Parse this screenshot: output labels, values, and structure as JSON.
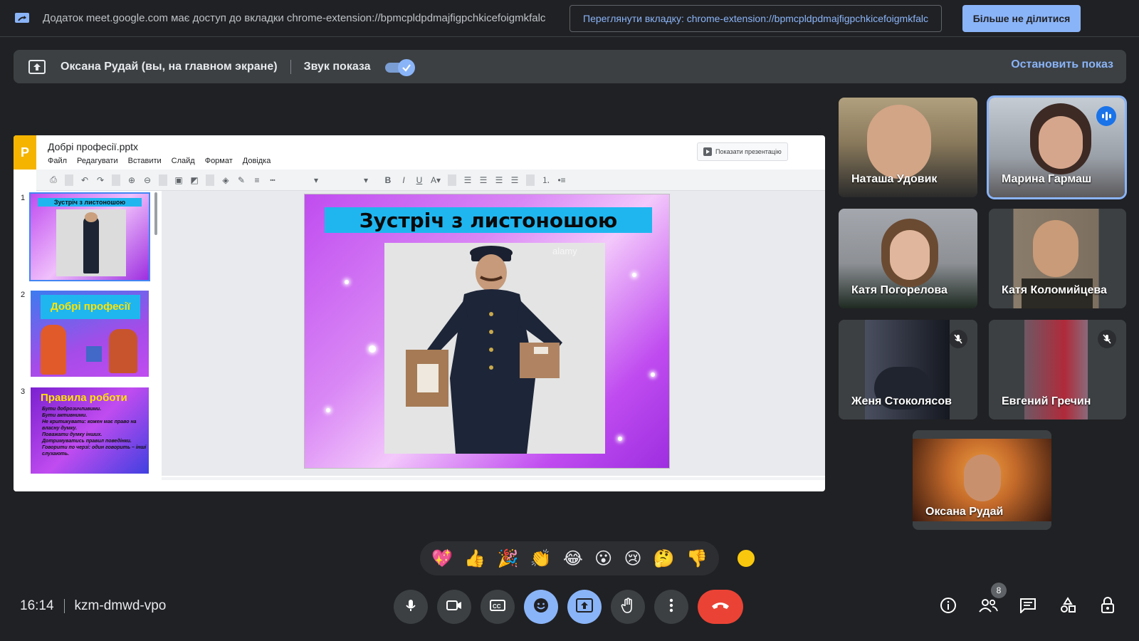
{
  "share_bar": {
    "message": "Додаток meet.google.com має доступ до вкладки chrome-extension://bpmcpldpdmajfigpchkicefoigmkfalc",
    "view_tab_label": "Переглянути вкладку: chrome-extension://bpmcpldpdmajfigpchkicefoigmkfalc",
    "stop_sharing_label": "Більше не ділитися"
  },
  "presenting_bar": {
    "presenter": "Оксана Рудай (вы, на главном экране)",
    "audio_label": "Звук показа",
    "audio_on": true,
    "stop_label": "Остановить показ"
  },
  "slides_app": {
    "doc_title": "Добрі професії.pptx",
    "logo_letter": "P",
    "menus": [
      "Файл",
      "Редагувати",
      "Вставити",
      "Слайд",
      "Формат",
      "Довідка"
    ],
    "present_label": "Показати презентацію",
    "thumbnails": [
      {
        "num": "1",
        "title": "Зустріч з листоношою"
      },
      {
        "num": "2",
        "title": "Добрі професії"
      },
      {
        "num": "3",
        "title": "Правила роботи",
        "lines": [
          "Бути доброзичливими.",
          "Бути активними.",
          "Не критикувати: кожен має право на власну думку.",
          "Поважати думку інших.",
          "Дотримуватись правил поведінки.",
          "Говорити по черзі: один говорить – інші слухають."
        ]
      }
    ],
    "current_slide_title": "Зустріч з листоношою",
    "watermark": "alamy"
  },
  "participants": [
    {
      "name": "Наташа Удовик",
      "muted": false,
      "speaking": false,
      "colors": [
        "#8a7a5c",
        "#2b2b2b"
      ]
    },
    {
      "name": "Марина Гармаш",
      "muted": false,
      "speaking": true,
      "colors": [
        "#b9bfc8",
        "#3d2a24"
      ]
    },
    {
      "name": "Катя Погорелова",
      "muted": false,
      "speaking": false,
      "colors": [
        "#9c9fa5",
        "#1e2a22"
      ]
    },
    {
      "name": "Катя Коломийцева",
      "muted": false,
      "speaking": false,
      "colors": [
        "#7d6f60",
        "#2c2a24"
      ]
    },
    {
      "name": "Женя Стоколясов",
      "muted": true,
      "speaking": false,
      "colors": [
        "#3a3f52",
        "#151820"
      ]
    },
    {
      "name": "Евгений Гречин",
      "muted": true,
      "speaking": false,
      "colors": [
        "#6f5864",
        "#b02a3a"
      ]
    },
    {
      "name": "Оксана Рудай",
      "muted": false,
      "speaking": false,
      "colors": [
        "#c46a2a",
        "#3a1a0e"
      ]
    }
  ],
  "reactions": [
    "💖",
    "👍",
    "🎉",
    "👏",
    "😂",
    "😮",
    "😢",
    "🤔",
    "👎"
  ],
  "meeting": {
    "time": "16:14",
    "code": "kzm-dmwd-vpo",
    "participant_count": "8"
  },
  "colors": {
    "accent": "#8ab4f8",
    "end_call": "#ea4335",
    "background": "#202124"
  }
}
